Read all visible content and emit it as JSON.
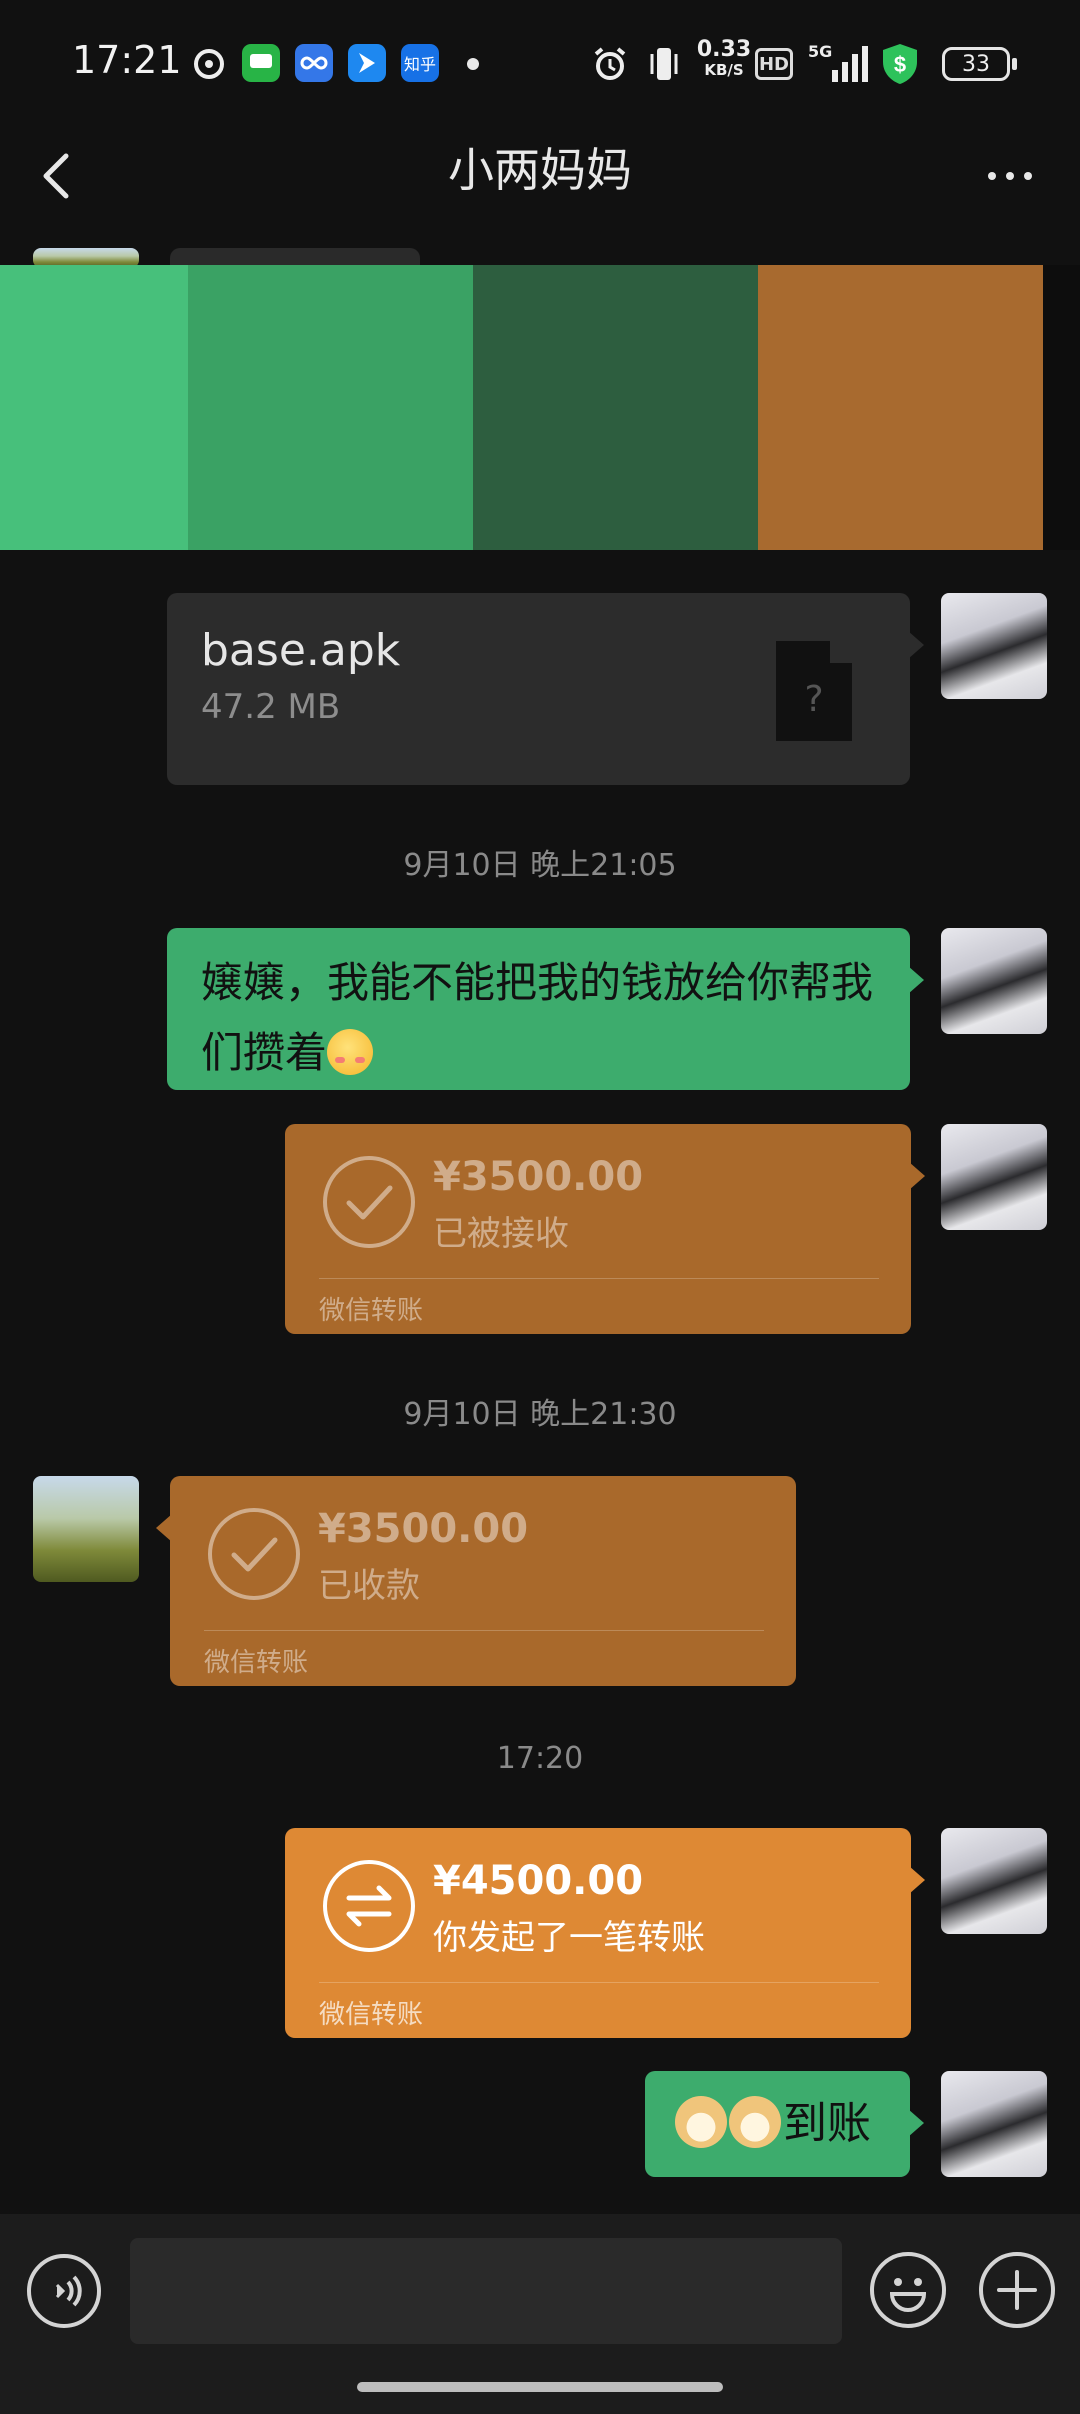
{
  "status_bar": {
    "time": "17:21",
    "network_speed_value": "0.33",
    "network_speed_unit": "KB/S",
    "hd_label": "HD",
    "signal_label": "5G",
    "battery_level": "33",
    "app_icons": [
      "netease-music-icon",
      "messages-icon",
      "infinity-app-icon",
      "feishu-icon",
      "zhihu-icon"
    ],
    "zhihu_label": "知乎"
  },
  "header": {
    "title": "小两妈妈"
  },
  "image_strip_colors": [
    "#47c07b",
    "#3aa264",
    "#2d5e3f",
    "#a86a2f",
    "#0d0d0d"
  ],
  "messages": {
    "file": {
      "name": "base.apk",
      "size": "47.2 MB",
      "icon_label": "?"
    },
    "ts1": "9月10日 晚上21:05",
    "text1": "嬢嬢，我能不能把我的钱放给你帮我们攒着",
    "transfer1": {
      "amount": "¥3500.00",
      "status": "已被接收",
      "footer": "微信转账"
    },
    "ts2": "9月10日 晚上21:30",
    "transfer2": {
      "amount": "¥3500.00",
      "status": "已收款",
      "footer": "微信转账"
    },
    "ts3": "17:20",
    "transfer3": {
      "amount": "¥4500.00",
      "status": "你发起了一笔转账",
      "footer": "微信转账"
    },
    "sticker_text": "到账"
  },
  "colors": {
    "sent_bubble": "#3dac6d",
    "transfer_done": "#a9692b",
    "transfer_pending": "#de8934",
    "background": "#111111"
  }
}
